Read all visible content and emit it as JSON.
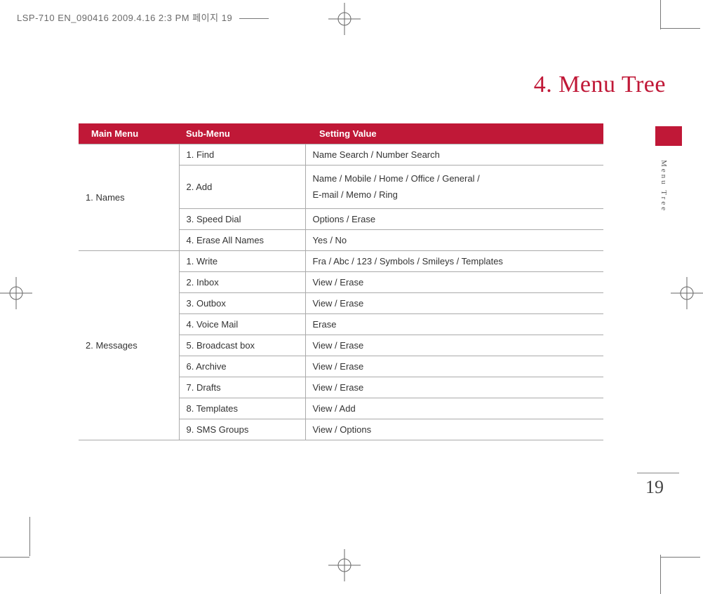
{
  "header_imprint": "LSP-710 EN_090416  2009.4.16 2:3 PM  페이지 19",
  "chapter_title": "4. Menu Tree",
  "side_label": "Menu Tree",
  "page_number": "19",
  "table": {
    "headers": {
      "col1": "Main Menu",
      "col2": "Sub-Menu",
      "col3": "Setting Value"
    },
    "sections": [
      {
        "main": "1. Names",
        "rows": [
          {
            "sub": "1. Find",
            "val": "Name Search / Number Search"
          },
          {
            "sub": "2. Add",
            "val": "Name / Mobile / Home / Office / General /\nE-mail / Memo / Ring"
          },
          {
            "sub": "3. Speed Dial",
            "val": "Options / Erase"
          },
          {
            "sub": "4. Erase All Names",
            "val": "Yes / No"
          }
        ]
      },
      {
        "main": "2. Messages",
        "rows": [
          {
            "sub": "1. Write",
            "val": "Fra / Abc / 123 / Symbols / Smileys / Templates"
          },
          {
            "sub": "2. Inbox",
            "val": "View / Erase"
          },
          {
            "sub": "3. Outbox",
            "val": "View / Erase"
          },
          {
            "sub": "4. Voice Mail",
            "val": "Erase"
          },
          {
            "sub": "5. Broadcast box",
            "val": "View / Erase"
          },
          {
            "sub": "6. Archive",
            "val": "View / Erase"
          },
          {
            "sub": "7. Drafts",
            "val": "View / Erase"
          },
          {
            "sub": "8. Templates",
            "val": "View / Add"
          },
          {
            "sub": "9. SMS Groups",
            "val": "View / Options"
          }
        ]
      }
    ]
  }
}
